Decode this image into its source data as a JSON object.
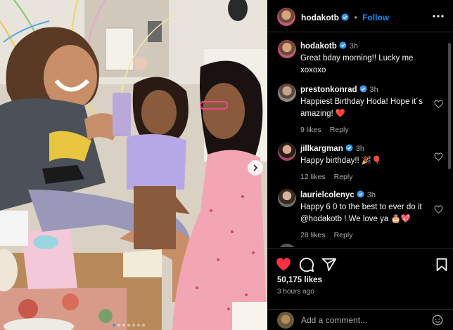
{
  "post": {
    "author": "hodakotb",
    "follow_label": "Follow",
    "separator": "•",
    "photo_count": 7,
    "active_photo": 1
  },
  "comments": [
    {
      "user": "hodakotb",
      "text": "Great bday morning!! Lucky me xoxoxo",
      "time": "3h",
      "verified": true,
      "likes": "",
      "reply": ""
    },
    {
      "user": "prestonkonrad",
      "text": "Happiest Birthday Hoda! Hope it´s amazing! ❤️",
      "time": "3h",
      "verified": true,
      "likes": "9 likes",
      "reply": "Reply"
    },
    {
      "user": "jillkargman",
      "text": "Happy birthday!! 🎉🎈",
      "time": "3h",
      "verified": true,
      "likes": "12 likes",
      "reply": "Reply"
    },
    {
      "user": "laurielcolenyc",
      "text": "Happy 6 0 to the best to ever do it @hodakotb ! We love ya 🎂💖",
      "time": "3h",
      "verified": true,
      "likes": "28 likes",
      "reply": "Reply"
    }
  ],
  "stats": {
    "likes": "50,175 likes",
    "posted": "3 hours ago"
  },
  "add_comment": {
    "placeholder": "Add a comment..."
  },
  "colors": {
    "like_red": "#ff3040",
    "link_blue": "#0095f6",
    "verified_blue": "#3897f0"
  },
  "icons": [
    "more-icon",
    "heart-icon",
    "comment-icon",
    "share-icon",
    "bookmark-icon",
    "emoji-icon",
    "chevron-right-icon",
    "verified-icon"
  ]
}
